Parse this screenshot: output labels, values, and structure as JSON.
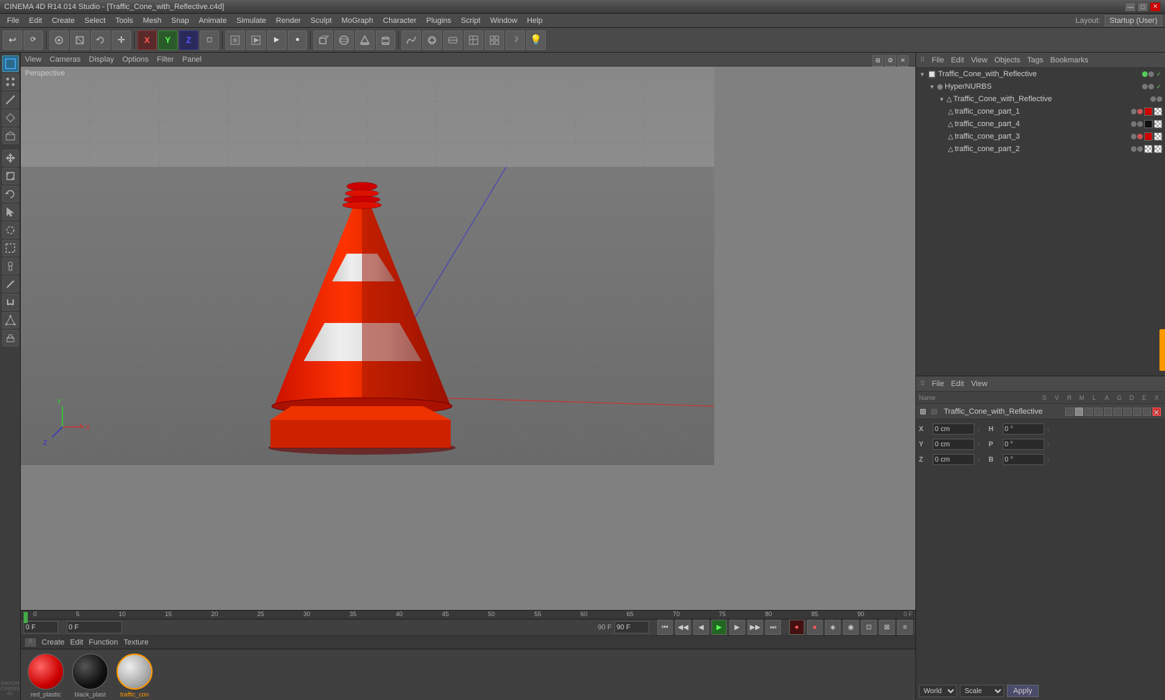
{
  "titleBar": {
    "text": "CINEMA 4D R14.014 Studio - [Traffic_Cone_with_Reflective.c4d]",
    "minimize": "—",
    "maximize": "□",
    "close": "✕"
  },
  "menuBar": {
    "items": [
      "File",
      "Edit",
      "Create",
      "Select",
      "Tools",
      "Mesh",
      "Snap",
      "Animate",
      "Simulate",
      "Render",
      "Sculpt",
      "MoGraph",
      "Character",
      "Plugins",
      "Script",
      "Window",
      "Help"
    ]
  },
  "layout": {
    "label": "Layout:",
    "preset": "Startup (User)"
  },
  "viewport": {
    "menus": [
      "View",
      "Cameras",
      "Display",
      "Options",
      "Filter",
      "Panel"
    ],
    "label": "Perspective"
  },
  "timeline": {
    "currentFrame": "0 F",
    "totalFrames": "90 F",
    "endFrame": "90 F",
    "markers": [
      "0",
      "5",
      "10",
      "15",
      "20",
      "25",
      "30",
      "35",
      "40",
      "45",
      "50",
      "55",
      "60",
      "65",
      "70",
      "75",
      "80",
      "85",
      "90"
    ]
  },
  "materialShelf": {
    "menus": [
      "Create",
      "Edit",
      "Function",
      "Texture"
    ],
    "materials": [
      {
        "name": "red_plastic",
        "type": "red-plastic"
      },
      {
        "name": "black_plast",
        "type": "black-plastic"
      },
      {
        "name": "traffic_con",
        "type": "traffic-con"
      }
    ]
  },
  "scenePanel": {
    "menus": [
      "File",
      "Edit",
      "View",
      "Objects",
      "Tags",
      "Bookmarks"
    ],
    "items": [
      {
        "name": "Traffic_Cone_with_Reflective",
        "level": 0,
        "icon": "🔲",
        "hasArrow": true,
        "dotColor": "green",
        "hasCheck": true
      },
      {
        "name": "HyperNURBS",
        "level": 1,
        "icon": "⊕",
        "hasArrow": true,
        "dotColor": "grey",
        "hasCheck": true
      },
      {
        "name": "Traffic_Cone_with_Reflective",
        "level": 2,
        "icon": "△",
        "hasArrow": true,
        "dotColor": "grey",
        "hasCheck": false
      },
      {
        "name": "traffic_cone_part_1",
        "level": 3,
        "icon": "△",
        "dotColor": "red",
        "swatch": "red"
      },
      {
        "name": "traffic_cone_part_4",
        "level": 3,
        "icon": "△",
        "dotColor": "grey",
        "swatch": "black"
      },
      {
        "name": "traffic_cone_part_3",
        "level": 3,
        "icon": "△",
        "dotColor": "red",
        "swatch": "red"
      },
      {
        "name": "traffic_cone_part_2",
        "level": 3,
        "icon": "△",
        "dotColor": "grey",
        "swatch": "checker"
      }
    ]
  },
  "attributesPanel": {
    "menus": [
      "File",
      "Edit",
      "View"
    ],
    "nameHeader": "Name",
    "colHeaders": [
      "S",
      "V",
      "R",
      "M",
      "L",
      "A",
      "G",
      "D",
      "E",
      "X"
    ],
    "objectName": "Traffic_Cone_with_Reflective",
    "fields": {
      "X": {
        "pos": "0 cm",
        "H": "0°"
      },
      "Y": {
        "pos": "0 cm",
        "P": "0°"
      },
      "Z": {
        "pos": "0 cm",
        "B": "0°"
      }
    },
    "coordSystem": "World",
    "transformMode": "Scale",
    "applyLabel": "Apply"
  },
  "toolbar": {
    "groups": [
      [
        "↩",
        "⟳",
        "◎",
        "↔",
        "↩",
        "◈",
        "Ⓧ",
        "Ⓨ",
        "Ⓩ",
        "◻"
      ],
      [
        "◻",
        "◻",
        "◻",
        "◻"
      ],
      [
        "▶",
        "⏺",
        "◻",
        "◻",
        "◻",
        "◻"
      ],
      [
        "◻",
        "◻",
        "◻",
        "◻",
        "◻",
        "◻",
        "◻",
        "◻",
        "☽"
      ]
    ]
  },
  "leftSidebar": {
    "items": [
      "↖",
      "◻",
      "✛",
      "◻",
      "↩",
      "△",
      "◻",
      "◻",
      "◻",
      "◻",
      "◻",
      "◻",
      "◻",
      "◻",
      "◻",
      "◻",
      "◻",
      "◻",
      "◻"
    ]
  }
}
